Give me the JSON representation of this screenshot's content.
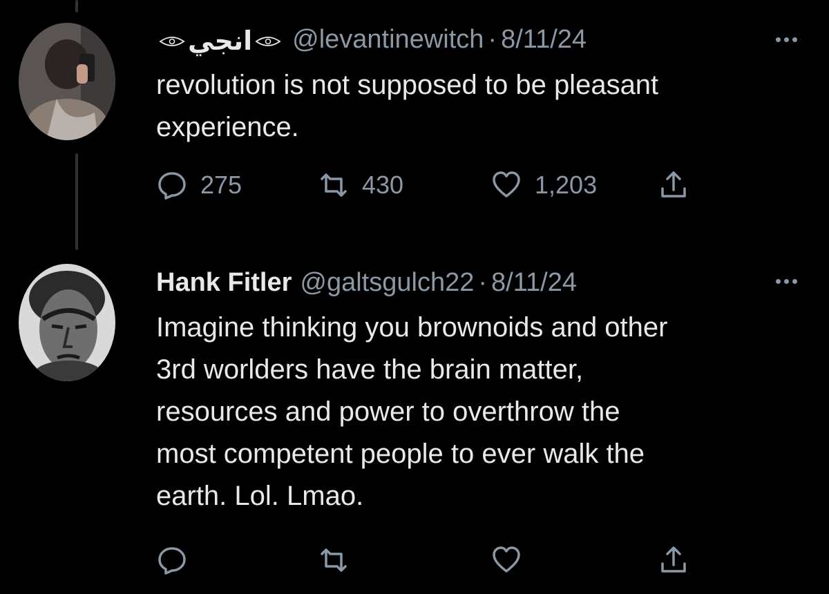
{
  "tweets": [
    {
      "display_name": "انجي",
      "handle": "@levantinewitch",
      "separator": "·",
      "date": "8/11/24",
      "text_lines": [
        "revolution is not supposed to be pleasant",
        "experience."
      ],
      "replies": "275",
      "retweets": "430",
      "likes": "1,203"
    },
    {
      "display_name": "Hank Fitler",
      "handle": "@galtsgulch22",
      "separator": "·",
      "date": "8/11/24",
      "text_lines": [
        "Imagine thinking you brownoids and other",
        "3rd worlders have the brain matter,",
        "resources and power to overthrow the",
        "most competent people to ever walk the",
        "earth. Lol. Lmao."
      ]
    }
  ],
  "icons": {
    "reply": "reply-icon",
    "retweet": "retweet-icon",
    "like": "heart-icon",
    "share": "share-icon",
    "more": "more-icon",
    "eye": "eye-icon"
  },
  "colors": {
    "background": "#000000",
    "text": "#e7e9ea",
    "muted": "#8b98a5",
    "thread_line": "#2f3336"
  }
}
